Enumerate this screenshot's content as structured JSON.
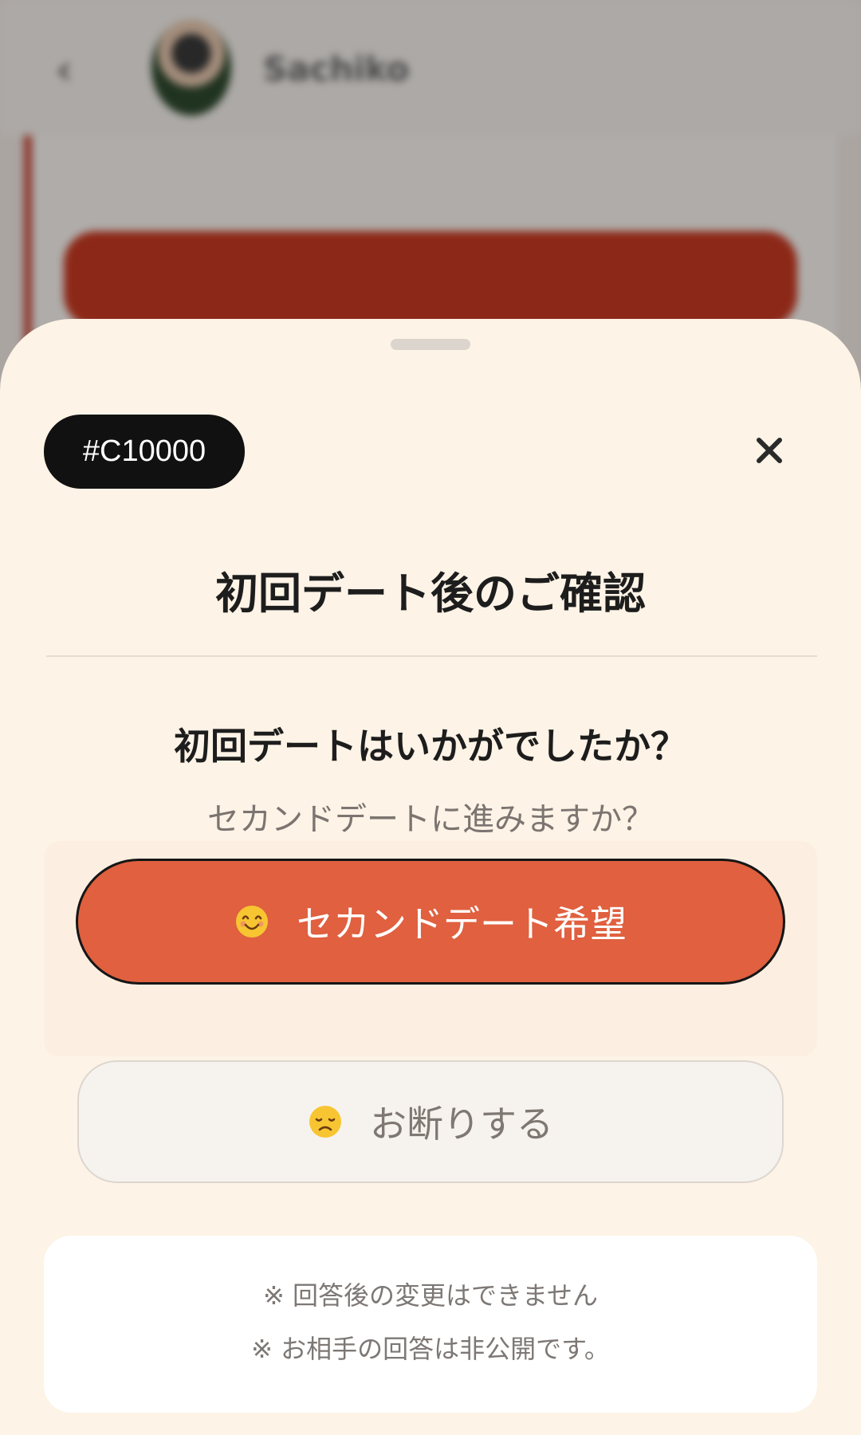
{
  "background": {
    "back_glyph": "‹",
    "user_name": "Sachiko",
    "card_text": "",
    "red_button_text": ""
  },
  "sheet": {
    "id_chip": "#C10000",
    "close_icon": "close-icon",
    "title": "初回デート後のご確認",
    "question": "初回デートはいかがでしたか？",
    "sub_question": "セカンドデートに進みますか？",
    "primary_button": {
      "emoji": "smiling-face-icon",
      "label": "セカンドデート希望"
    },
    "secondary_button": {
      "emoji": "disappointed-face-icon",
      "label": "お断りする"
    },
    "notes": [
      "※ 回答後の変更はできません",
      "※ お相手の回答は非公開です。"
    ]
  },
  "colors": {
    "accent": "#e0603f",
    "sheet_bg": "#fdf3e6",
    "chip_bg": "#111111"
  }
}
